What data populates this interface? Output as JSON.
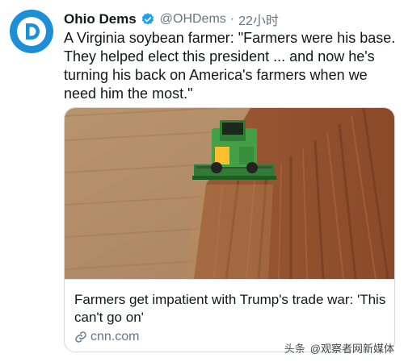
{
  "tweet": {
    "display_name": "Ohio Dems",
    "handle": "@OHDems",
    "separator": "·",
    "time": "22小时",
    "text": "A Virginia soybean farmer: \"Farmers were his base. They helped elect this president ... and now he's turning his back on America's farmers when we need him the most.\""
  },
  "avatar": {
    "letter": "D",
    "color": "#1d8fd6"
  },
  "card": {
    "title": "Farmers get impatient with Trump's trade war: 'This can't go on'",
    "domain": "cnn.com"
  },
  "watermark": {
    "source": "头条",
    "account": "@观察者网新媒体"
  },
  "colors": {
    "verified": "#1da1f2",
    "secondary_text": "#657786",
    "card_border": "#d4dbe1"
  },
  "icons": [
    "verified-badge-icon",
    "link-icon",
    "democratic-party-logo-icon"
  ]
}
